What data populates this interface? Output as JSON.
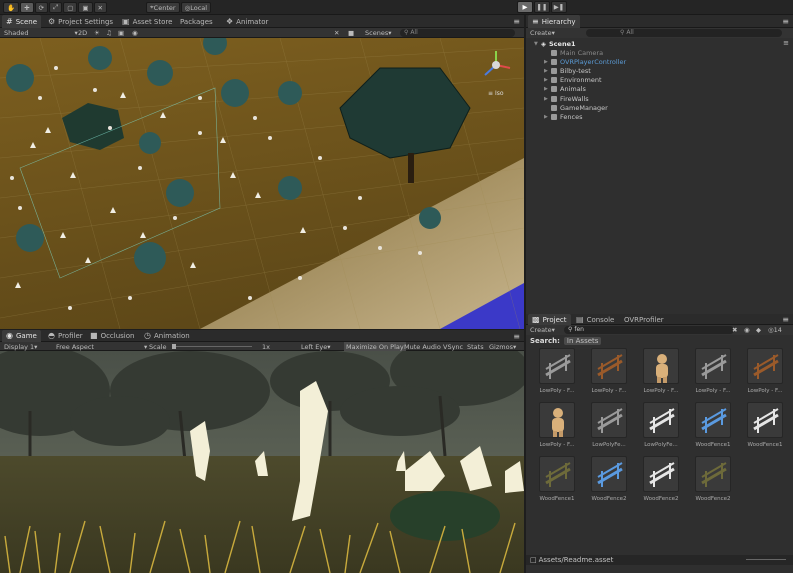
{
  "toolbar": {
    "pivot": "Center",
    "space": "Local"
  },
  "scene_tabs": [
    "Scene",
    "Project Settings",
    "Asset Store",
    "Packages",
    "Animator"
  ],
  "scene_bar": {
    "shading": "Shaded",
    "mode": "2D",
    "scenes_label": "Scenes",
    "search": "All"
  },
  "gizmo": {
    "projection": "Iso"
  },
  "hierarchy": {
    "title": "Hierarchy",
    "create": "Create",
    "search": "All",
    "scene": "Scene1",
    "items": [
      {
        "label": "Main Camera",
        "color": "#8a8a8a",
        "expandable": false
      },
      {
        "label": "OVRPlayerController",
        "color": "#5b9bd5",
        "expandable": true
      },
      {
        "label": "Bilby-test",
        "color": "#c8c8c8",
        "expandable": true
      },
      {
        "label": "Environment",
        "color": "#c8c8c8",
        "expandable": true
      },
      {
        "label": "Animals",
        "color": "#c8c8c8",
        "expandable": true
      },
      {
        "label": "FireWalls",
        "color": "#c8c8c8",
        "expandable": true
      },
      {
        "label": "GameManager",
        "color": "#c8c8c8",
        "expandable": false
      },
      {
        "label": "Fences",
        "color": "#c8c8c8",
        "expandable": true
      }
    ]
  },
  "game_tabs": [
    "Game",
    "Profiler",
    "Occlusion",
    "Animation"
  ],
  "game_bar": {
    "display": "Display 1",
    "aspect": "Free Aspect",
    "scale_label": "Scale",
    "scale_value": "1x",
    "eye": "Left Eye",
    "maximize": "Maximize On Play",
    "mute": "Mute Audio",
    "vsync": "VSync",
    "stats": "Stats",
    "gizmos": "Gizmos"
  },
  "project": {
    "tabs": [
      "Project",
      "Console",
      "OVRProfiler"
    ],
    "create": "Create",
    "search_value": "fen",
    "count": "14",
    "search_label": "Search:",
    "scope": "In Assets",
    "assets": [
      {
        "label": "LowPoly - F...",
        "kind": "fence-gray"
      },
      {
        "label": "LowPoly - F...",
        "kind": "fence-brown"
      },
      {
        "label": "LowPoly - F...",
        "kind": "figure"
      },
      {
        "label": "LowPoly - F...",
        "kind": "fence-gray"
      },
      {
        "label": "LowPoly - F...",
        "kind": "fence-brown"
      },
      {
        "label": "LowPoly - F...",
        "kind": "figure"
      },
      {
        "label": "LowPolyFe...",
        "kind": "fence-gray"
      },
      {
        "label": "LowPolyFe...",
        "kind": "fence-white"
      },
      {
        "label": "WoodFence1",
        "kind": "fence-blue"
      },
      {
        "label": "WoodFence1",
        "kind": "fence-white"
      },
      {
        "label": "WoodFence1",
        "kind": "fence-olive"
      },
      {
        "label": "WoodFence2",
        "kind": "fence-blue"
      },
      {
        "label": "WoodFence2",
        "kind": "fence-white"
      },
      {
        "label": "WoodFence2",
        "kind": "fence-olive"
      }
    ],
    "footer": "Assets/Readme.asset"
  }
}
